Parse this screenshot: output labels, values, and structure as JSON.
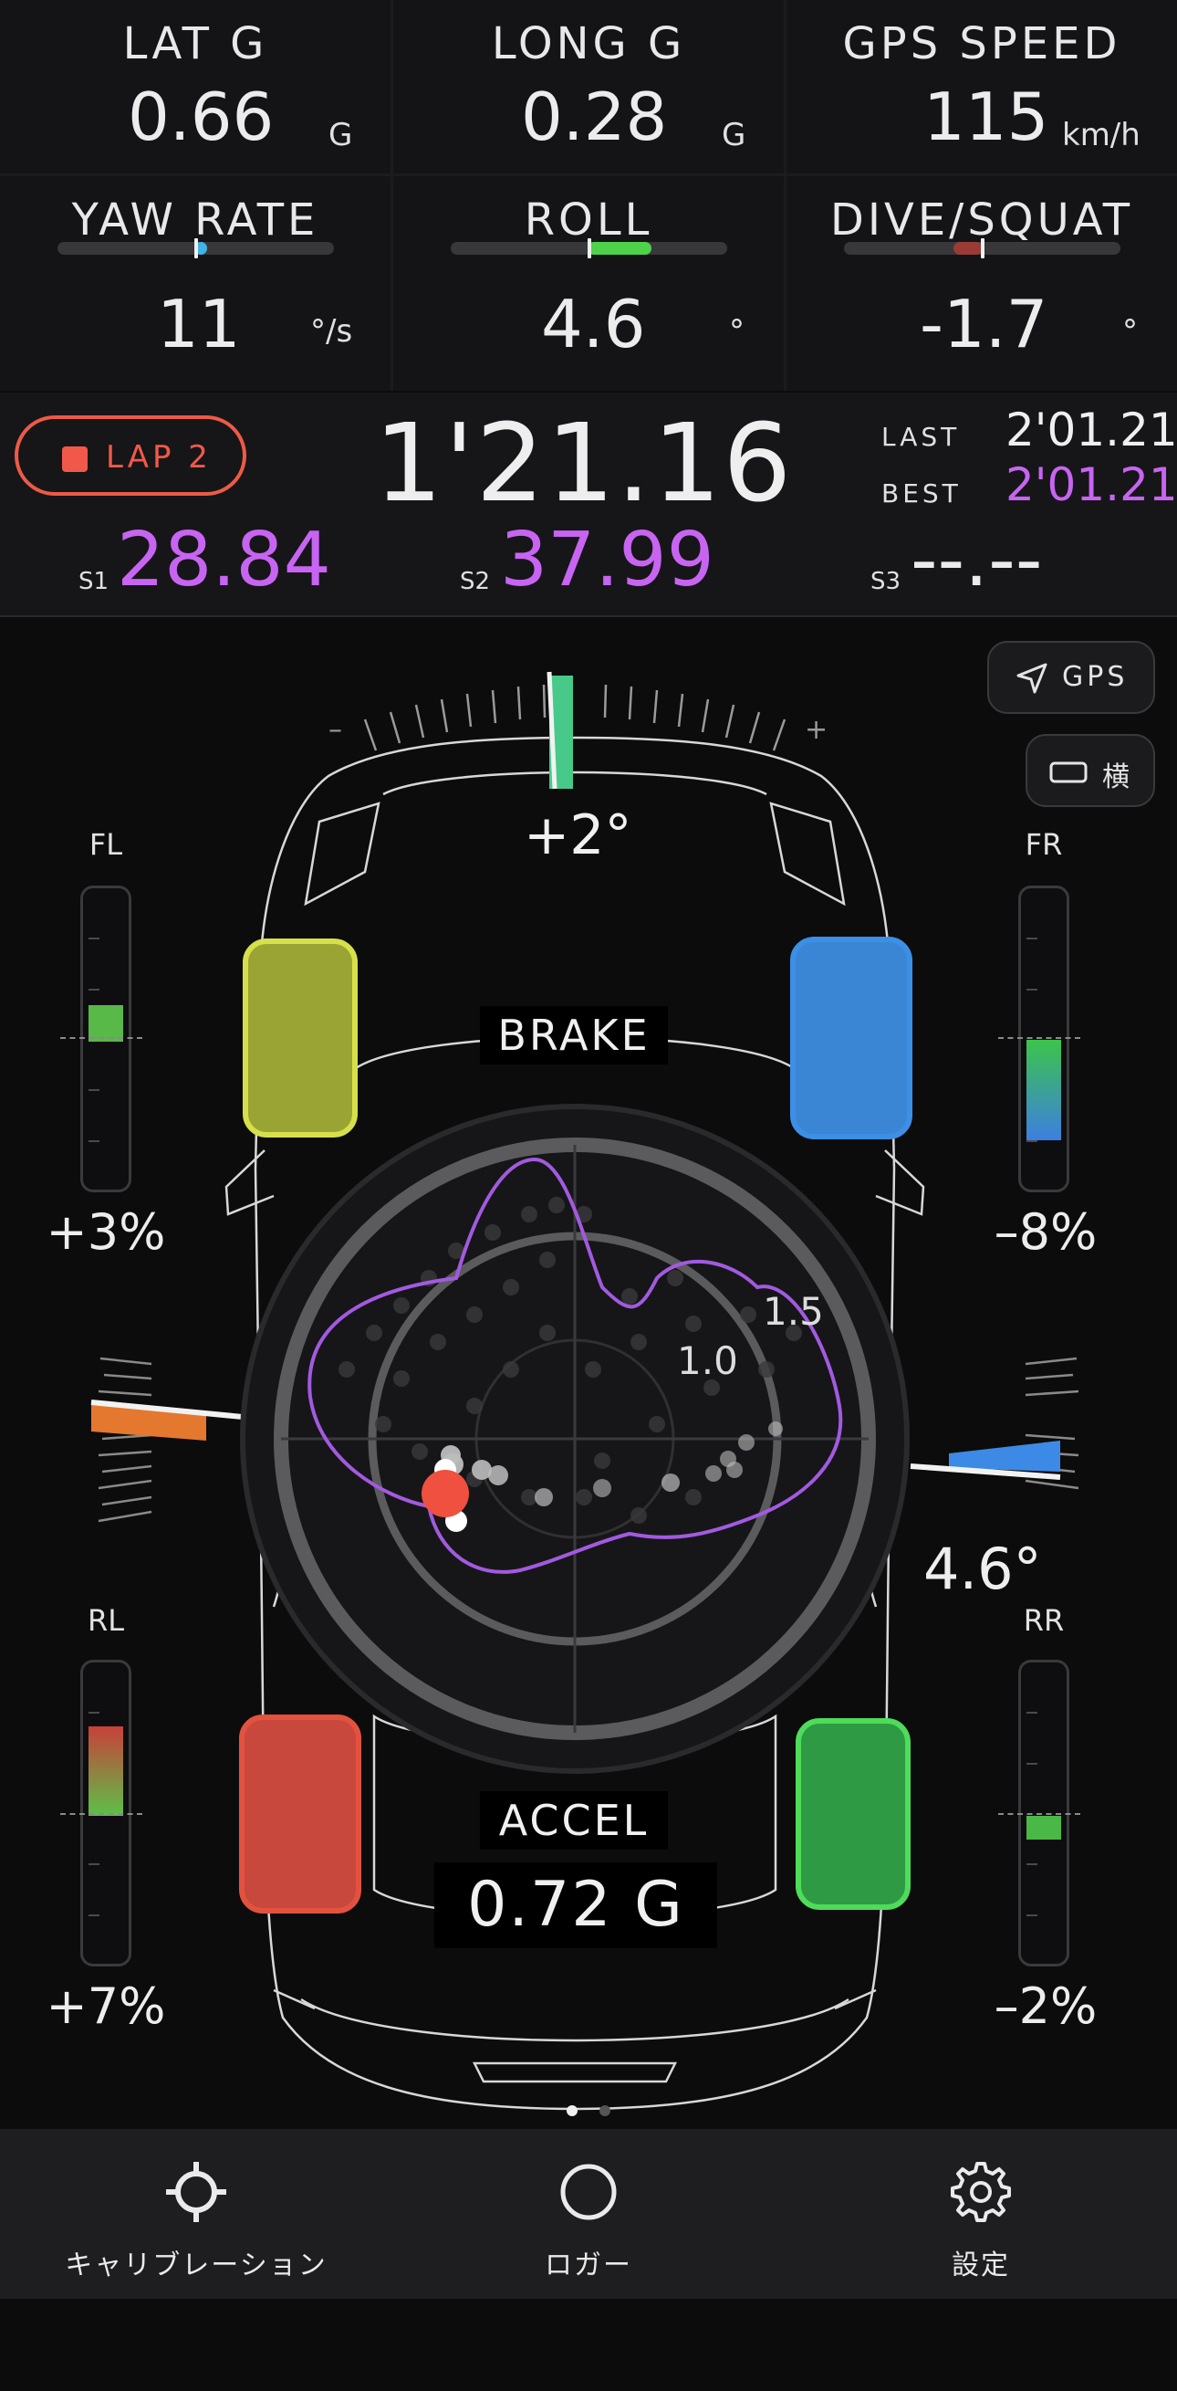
{
  "metrics": {
    "lat_g": {
      "label": "LAT G",
      "value": "0.66",
      "unit": "G"
    },
    "long_g": {
      "label": "LONG G",
      "value": "0.28",
      "unit": "G"
    },
    "gps_speed": {
      "label": "GPS SPEED",
      "value": "115",
      "unit": "km/h"
    },
    "yaw_rate": {
      "label": "YAW RATE",
      "value": "11",
      "unit": "°/s",
      "bar_color": "#3fb4e6"
    },
    "roll": {
      "label": "ROLL",
      "value": "4.6",
      "unit": "°",
      "bar_color": "#4ed24a"
    },
    "dive_squat": {
      "label": "DIVE/SQUAT",
      "value": "-1.7",
      "unit": "°",
      "bar_color": "#9a3b35"
    }
  },
  "lap": {
    "button_label": "LAP 2",
    "current_time": "1'21.16",
    "last_label": "LAST",
    "last_time": "2'01.21",
    "best_label": "BEST",
    "best_time": "2'01.21",
    "s1_label": "S1",
    "s1_time": "28.84",
    "s2_label": "S2",
    "s2_time": "37.99",
    "s3_label": "S3",
    "s3_time": "--.--"
  },
  "controls": {
    "gps_label": "GPS",
    "orientation_label": "横"
  },
  "steering": {
    "minus": "–",
    "plus": "+",
    "angle": "+2°"
  },
  "tires": {
    "fl": {
      "label": "FL",
      "pct": "+3%",
      "color": "#9aa434"
    },
    "fr": {
      "label": "FR",
      "pct": "–8%",
      "color": "#3a86d4"
    },
    "rl": {
      "label": "RL",
      "pct": "+7%",
      "color": "#c8483d"
    },
    "rr": {
      "label": "RR",
      "pct": "–2%",
      "color": "#2e9a44"
    }
  },
  "gauge": {
    "brake_label": "BRAKE",
    "accel_label": "ACCEL",
    "accel_value": "0.72 G",
    "ring_1_0": "1.0",
    "ring_1_5": "1.5",
    "roll_angle": "4.6°"
  },
  "nav": {
    "calibration": "キャリブレーション",
    "logger": "ロガー",
    "settings": "設定"
  },
  "colors": {
    "accent_purple": "#c864f2",
    "lap_red": "#f2584a"
  }
}
